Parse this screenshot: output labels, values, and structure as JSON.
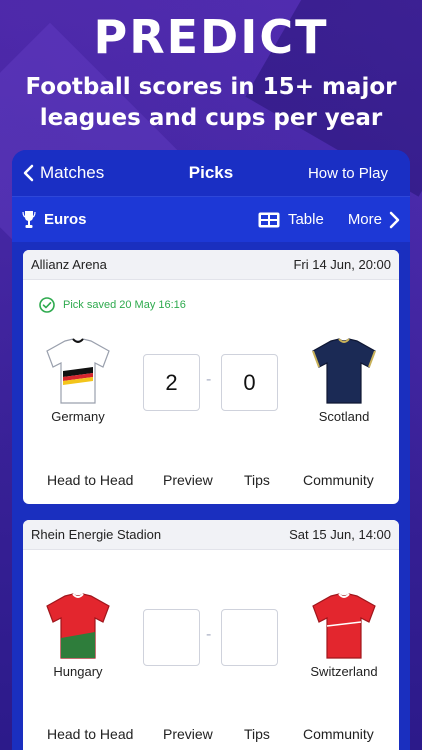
{
  "hero": {
    "title": "PREDICT",
    "subtitle_line1": "Football scores in 15+ major",
    "subtitle_line2": "leagues and cups per year"
  },
  "nav": {
    "back_label": "Matches",
    "title": "Picks",
    "how_to_play": "How to Play"
  },
  "subbar": {
    "competition": "Euros",
    "table_label": "Table",
    "more_label": "More"
  },
  "matches": [
    {
      "venue": "Allianz Arena",
      "date": "Fri 14 Jun, 20:00",
      "saved_text": "Pick saved 20 May 16:16",
      "home": {
        "name": "Germany",
        "kit_color": "#ffffff",
        "kit_accent": "#111111"
      },
      "away": {
        "name": "Scotland",
        "kit_color": "#1b2a55",
        "kit_accent": "#c9b25a"
      },
      "home_score": "2",
      "away_score": "0",
      "dash": "-",
      "tabs": [
        "Head to Head",
        "Preview",
        "Tips",
        "Community"
      ]
    },
    {
      "venue": "Rhein Energie Stadion",
      "date": "Sat 15 Jun, 14:00",
      "home": {
        "name": "Hungary",
        "kit_color": "#e3262e",
        "kit_accent": "#2e7d3b"
      },
      "away": {
        "name": "Switzerland",
        "kit_color": "#e3262e",
        "kit_accent": "#ffffff"
      },
      "home_score": "",
      "away_score": "",
      "dash": "-",
      "tabs": [
        "Head to Head",
        "Preview",
        "Tips",
        "Community"
      ]
    }
  ],
  "colors": {
    "nav_blue": "#1a2fc4",
    "saved_green": "#2eaa4e"
  }
}
